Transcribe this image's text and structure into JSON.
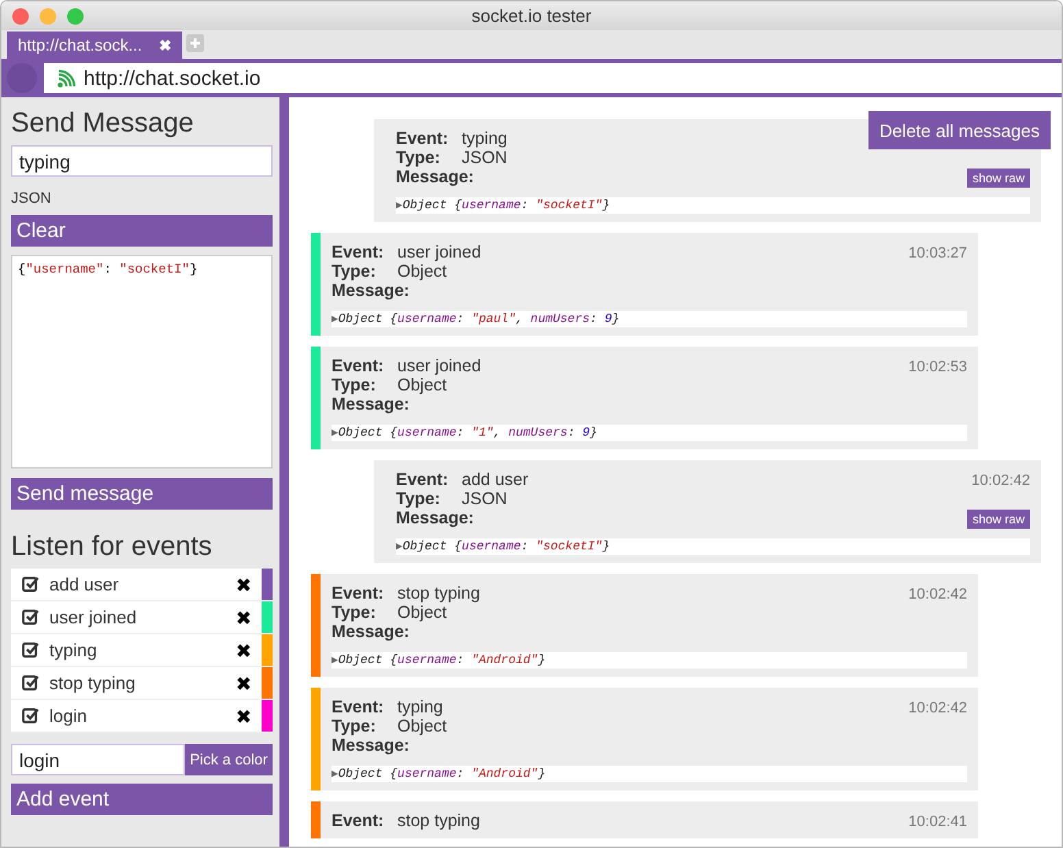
{
  "window": {
    "title": "socket.io tester"
  },
  "tabs": [
    {
      "label": "http://chat.sock...",
      "selected": true,
      "close": "✖"
    }
  ],
  "address_bar": {
    "url": "http://chat.socket.io"
  },
  "send_panel": {
    "title": "Send Message",
    "event_field": {
      "value": "typing"
    },
    "format": "JSON",
    "clear_button": "Clear",
    "payload": [
      {
        "text": "{",
        "kind": "punct"
      },
      {
        "text": "\"username\"",
        "kind": "string"
      },
      {
        "text": ": ",
        "kind": "punct"
      },
      {
        "text": "\"socketI\"",
        "kind": "string"
      },
      {
        "text": "}",
        "kind": "punct"
      }
    ],
    "send_button": "Send message"
  },
  "listen_panel": {
    "title": "Listen for events",
    "events": [
      {
        "name": "add user",
        "checked": true,
        "color": "#7b55ab",
        "remove": "✖"
      },
      {
        "name": "user joined",
        "checked": true,
        "color": "#1de99b",
        "remove": "✖"
      },
      {
        "name": "typing",
        "checked": true,
        "color": "#ffa400",
        "remove": "✖"
      },
      {
        "name": "stop typing",
        "checked": true,
        "color": "#ff7300",
        "remove": "✖"
      },
      {
        "name": "login",
        "checked": true,
        "color": "#ff00cc",
        "remove": "✖"
      }
    ],
    "new_event_field": {
      "value": "login"
    },
    "color_button": "Pick a color",
    "add_button": "Add event"
  },
  "delete_button": "Delete all messages",
  "messages": [
    {
      "kind": "sent",
      "event_label": "Event:",
      "event": "typing",
      "type_label": "Type:",
      "type": "JSON",
      "message_label": "Message:",
      "raw_button": "show raw",
      "preview": [
        {
          "text": "▶",
          "kind": "arrow"
        },
        {
          "text": "Object {",
          "kind": "label"
        },
        {
          "text": "username",
          "kind": "k"
        },
        {
          "text": ": ",
          "kind": "punct"
        },
        {
          "text": "\"socketI\"",
          "kind": "string"
        },
        {
          "text": "}",
          "kind": "punct"
        }
      ]
    },
    {
      "kind": "received",
      "color": "#1de99b",
      "event_label": "Event:",
      "event": "user joined",
      "type_label": "Type:",
      "type": "Object",
      "message_label": "Message:",
      "time": "10:03:27",
      "preview": [
        {
          "text": "▶",
          "kind": "arrow"
        },
        {
          "text": "Object {",
          "kind": "label"
        },
        {
          "text": "username",
          "kind": "k"
        },
        {
          "text": ": ",
          "kind": "punct"
        },
        {
          "text": "\"paul\"",
          "kind": "string"
        },
        {
          "text": ", ",
          "kind": "punct"
        },
        {
          "text": "numUsers",
          "kind": "k"
        },
        {
          "text": ": ",
          "kind": "punct"
        },
        {
          "text": "9",
          "kind": "number"
        },
        {
          "text": "}",
          "kind": "punct"
        }
      ]
    },
    {
      "kind": "received",
      "color": "#1de99b",
      "event_label": "Event:",
      "event": "user joined",
      "type_label": "Type:",
      "type": "Object",
      "message_label": "Message:",
      "time": "10:02:53",
      "preview": [
        {
          "text": "▶",
          "kind": "arrow"
        },
        {
          "text": "Object {",
          "kind": "label"
        },
        {
          "text": "username",
          "kind": "k"
        },
        {
          "text": ": ",
          "kind": "punct"
        },
        {
          "text": "\"1\"",
          "kind": "string"
        },
        {
          "text": ", ",
          "kind": "punct"
        },
        {
          "text": "numUsers",
          "kind": "k"
        },
        {
          "text": ": ",
          "kind": "punct"
        },
        {
          "text": "9",
          "kind": "number"
        },
        {
          "text": "}",
          "kind": "punct"
        }
      ]
    },
    {
      "kind": "sent",
      "event_label": "Event:",
      "event": "add user",
      "type_label": "Type:",
      "type": "JSON",
      "message_label": "Message:",
      "time": "10:02:42",
      "raw_button": "show raw",
      "preview": [
        {
          "text": "▶",
          "kind": "arrow"
        },
        {
          "text": "Object {",
          "kind": "label"
        },
        {
          "text": "username",
          "kind": "k"
        },
        {
          "text": ": ",
          "kind": "punct"
        },
        {
          "text": "\"socketI\"",
          "kind": "string"
        },
        {
          "text": "}",
          "kind": "punct"
        }
      ]
    },
    {
      "kind": "received",
      "color": "#ff7300",
      "event_label": "Event:",
      "event": "stop typing",
      "type_label": "Type:",
      "type": "Object",
      "message_label": "Message:",
      "time": "10:02:42",
      "preview": [
        {
          "text": "▶",
          "kind": "arrow"
        },
        {
          "text": "Object {",
          "kind": "label"
        },
        {
          "text": "username",
          "kind": "k"
        },
        {
          "text": ": ",
          "kind": "punct"
        },
        {
          "text": "\"Android\"",
          "kind": "string"
        },
        {
          "text": "}",
          "kind": "punct"
        }
      ]
    },
    {
      "kind": "received",
      "color": "#ffa400",
      "event_label": "Event:",
      "event": "typing",
      "type_label": "Type:",
      "type": "Object",
      "message_label": "Message:",
      "time": "10:02:42",
      "preview": [
        {
          "text": "▶",
          "kind": "arrow"
        },
        {
          "text": "Object {",
          "kind": "label"
        },
        {
          "text": "username",
          "kind": "k"
        },
        {
          "text": ": ",
          "kind": "punct"
        },
        {
          "text": "\"Android\"",
          "kind": "string"
        },
        {
          "text": "}",
          "kind": "punct"
        }
      ]
    },
    {
      "kind": "received",
      "color": "#ff7300",
      "event_label": "Event:",
      "event": "stop typing",
      "time": "10:02:41"
    }
  ]
}
